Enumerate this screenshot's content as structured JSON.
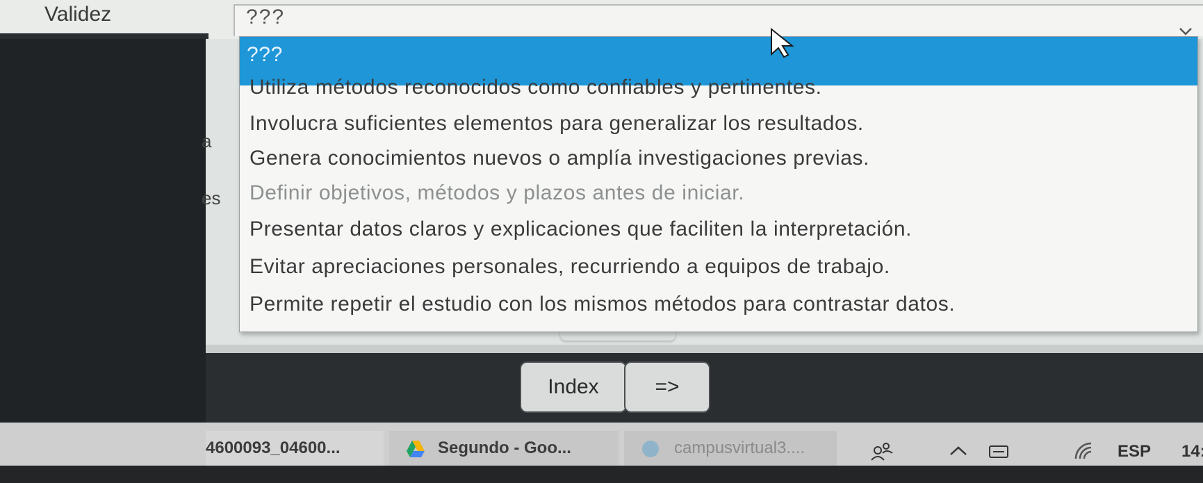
{
  "form": {
    "field_label": "Validez",
    "selected_value": "???"
  },
  "partial_labels": [
    "a",
    "es"
  ],
  "dropdown": {
    "selected": "???",
    "options": [
      "Utiliza métodos reconocidos como confiables y pertinentes.",
      "Involucra suficientes elementos para generalizar los resultados.",
      "Genera conocimientos nuevos o amplía investigaciones previas.",
      "Definir objetivos, métodos y plazos antes de iniciar.",
      "Presentar datos claros y explicaciones que faciliten la interpretación.",
      "Evitar apreciaciones personales, recurriendo a equipos de trabajo.",
      "Permite repetir el estudio con los mismos métodos para contrastar datos."
    ]
  },
  "nav": {
    "index_label": "Index",
    "next_label": "=>"
  },
  "taskbar": {
    "items": [
      "4600093_04600...",
      "Segundo - Goo...",
      "campusvirtual3...."
    ],
    "language": "ESP",
    "time": "14:"
  },
  "icons": {
    "chevron": "chevron-down-icon",
    "cursor": "mouse-pointer-icon",
    "drive": "google-drive-icon",
    "globe": "browser-icon",
    "people": "people-icon",
    "caret": "caret-up-icon",
    "keyboard": "keyboard-icon",
    "wifi": "wifi-icon"
  },
  "colors": {
    "highlight": "#1e96d8",
    "panel": "#202326"
  }
}
